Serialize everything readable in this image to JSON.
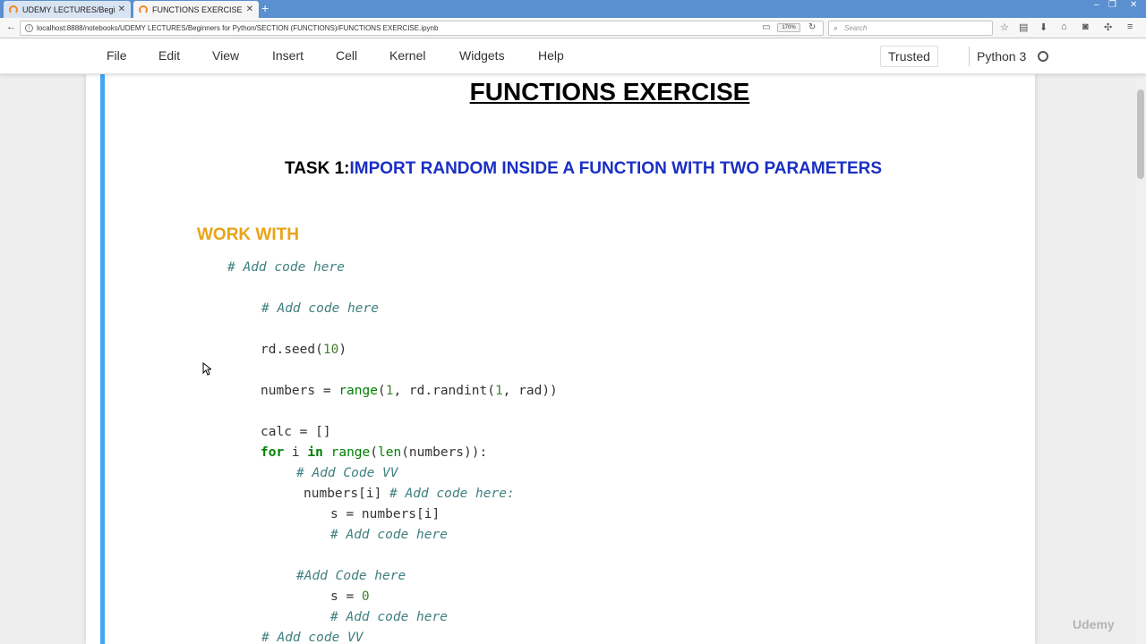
{
  "browser": {
    "tabs": [
      {
        "label": "UDEMY LECTURES/Beginne"
      },
      {
        "label": "FUNCTIONS EXERCISE"
      }
    ],
    "url": "localhost:8888/notebooks/UDEMY LECTURES/Beginners for Python/SECTION (FUNCTIONS)/FUNCTIONS EXERCISE.ipynb",
    "zoom": "170%",
    "search_placeholder": "Search"
  },
  "menubar": {
    "items": [
      "File",
      "Edit",
      "View",
      "Insert",
      "Cell",
      "Kernel",
      "Widgets",
      "Help"
    ],
    "trusted": "Trusted",
    "kernel": "Python 3"
  },
  "notebook": {
    "heading": "FUNCTIONS EXERCISE",
    "task_prefix": "TASK 1:",
    "task_text": "IMPORT RANDOM INSIDE A FUNCTION WITH TWO PARAMETERS",
    "work_with": "WORK WITH"
  },
  "watermark": "Udemy",
  "colors": {
    "cell_bar": "#42a5f5",
    "task_blue": "#1a2fc4",
    "work_with_orange": "#e8a317",
    "comment": "#408080",
    "keyword": "#008000"
  }
}
